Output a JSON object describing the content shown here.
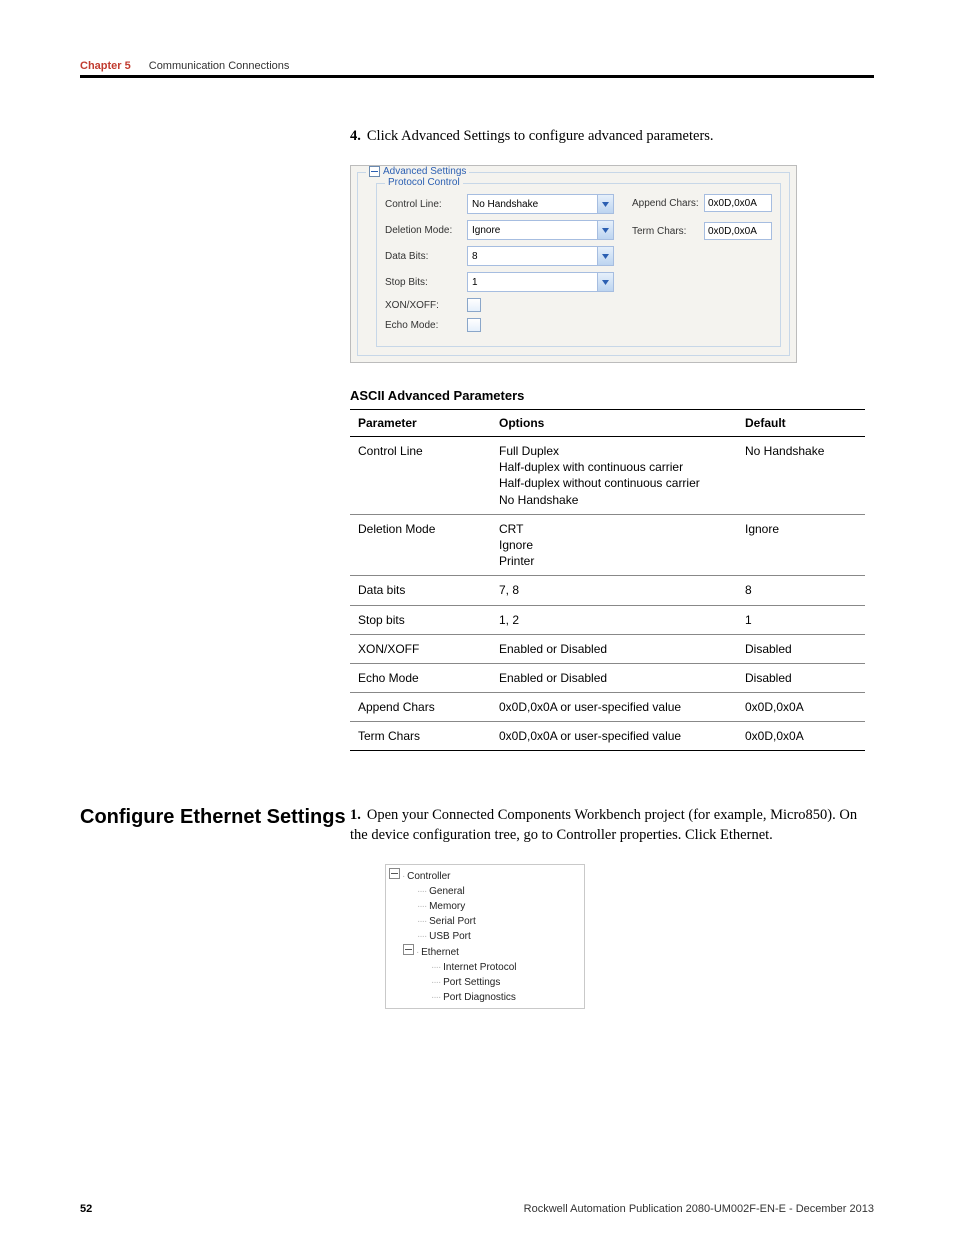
{
  "header": {
    "chapter": "Chapter 5",
    "title": "Communication Connections"
  },
  "step4": {
    "num": "4.",
    "text": "Click Advanced Settings to configure advanced parameters."
  },
  "adv_panel": {
    "legend": "Advanced Settings",
    "inner_legend": "Protocol Control",
    "control_line_label": "Control Line:",
    "control_line_value": "No Handshake",
    "deletion_mode_label": "Deletion Mode:",
    "deletion_mode_value": "Ignore",
    "data_bits_label": "Data Bits:",
    "data_bits_value": "8",
    "stop_bits_label": "Stop Bits:",
    "stop_bits_value": "1",
    "xonxoff_label": "XON/XOFF:",
    "echo_label": "Echo Mode:",
    "append_label": "Append Chars:",
    "append_value": "0x0D,0x0A",
    "term_label": "Term Chars:",
    "term_value": "0x0D,0x0A"
  },
  "table_title": "ASCII Advanced Parameters",
  "table": {
    "headers": [
      "Parameter",
      "Options",
      "Default"
    ],
    "rows": [
      {
        "p": "Control Line",
        "o": "Full Duplex\nHalf-duplex with continuous carrier\nHalf-duplex without continuous carrier\nNo Handshake",
        "d": "No Handshake"
      },
      {
        "p": "Deletion Mode",
        "o": "CRT\nIgnore\nPrinter",
        "d": "Ignore"
      },
      {
        "p": "Data bits",
        "o": "7, 8",
        "d": "8"
      },
      {
        "p": "Stop bits",
        "o": "1, 2",
        "d": "1"
      },
      {
        "p": "XON/XOFF",
        "o": "Enabled or Disabled",
        "d": "Disabled"
      },
      {
        "p": "Echo Mode",
        "o": "Enabled or Disabled",
        "d": "Disabled"
      },
      {
        "p": "Append Chars",
        "o": "0x0D,0x0A or user-specified value",
        "d": "0x0D,0x0A"
      },
      {
        "p": "Term Chars",
        "o": "0x0D,0x0A or user-specified value",
        "d": "0x0D,0x0A"
      }
    ]
  },
  "section": {
    "heading": "Configure Ethernet Settings",
    "step1_num": "1.",
    "step1_text": "Open your Connected Components Workbench project (for example, Micro850). On the device configuration tree, go to Controller properties. Click Ethernet."
  },
  "tree": {
    "root": "Controller",
    "items": [
      "General",
      "Memory",
      "Serial Port",
      "USB Port"
    ],
    "ethernet": "Ethernet",
    "ethernet_children": [
      "Internet Protocol",
      "Port Settings",
      "Port Diagnostics"
    ]
  },
  "footer": {
    "page": "52",
    "pub": "Rockwell Automation Publication 2080-UM002F-EN-E - December 2013"
  }
}
